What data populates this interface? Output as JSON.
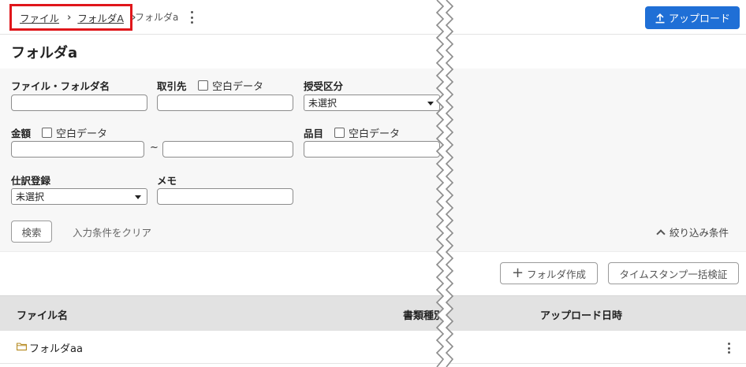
{
  "breadcrumb": {
    "items": [
      "ファイル",
      "フォルダA"
    ],
    "current": "フォルダa"
  },
  "header": {
    "upload_label": "アップロード"
  },
  "page_title": "フォルダa",
  "filter": {
    "file_folder_name_label": "ファイル・フォルダ名",
    "partner_label": "取引先",
    "transfer_type_label": "授受区分",
    "amount_label": "金額",
    "item_label": "品目",
    "journal_label": "仕訳登録",
    "memo_label": "メモ",
    "blank_data_label": "空白データ",
    "transfer_type_value": "未選択",
    "journal_value": "未選択",
    "range_separator": "~",
    "search_label": "検索",
    "clear_label": "入力条件をクリア",
    "collapse_label": "絞り込み条件"
  },
  "actions": {
    "create_folder_label": "フォルダ作成",
    "bulk_timestamp_label": "タイムスタンプ一括検証"
  },
  "table": {
    "columns": [
      "ファイル名",
      "書類種別",
      "アップロード日時"
    ],
    "rows": [
      {
        "name": "フォルダaa"
      }
    ]
  },
  "colors": {
    "primary": "#1f6fd6",
    "highlight": "#e0161b",
    "folder": "#b5891f"
  }
}
